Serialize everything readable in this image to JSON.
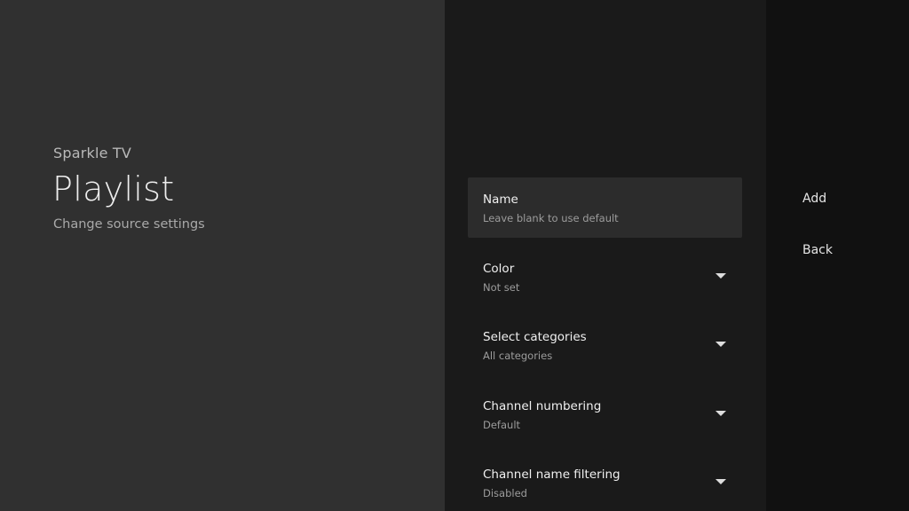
{
  "header": {
    "app_name": "Sparkle TV",
    "title": "Playlist",
    "subtitle": "Change source settings"
  },
  "settings": {
    "items": [
      {
        "title": "Name",
        "value": "Leave blank to use default",
        "focused": true,
        "icon": null
      },
      {
        "title": "Color",
        "value": "Not set",
        "icon": "dropdown-arrow"
      },
      {
        "title": "Select categories",
        "value": "All categories",
        "icon": "dropdown-arrow"
      },
      {
        "title": "Channel numbering",
        "value": "Default",
        "icon": "dropdown-arrow"
      },
      {
        "title": "Channel name filtering",
        "value": "Disabled",
        "icon": "dropdown-arrow"
      }
    ]
  },
  "actions": {
    "add_label": "Add",
    "back_label": "Back"
  },
  "colors": {
    "left_panel": "#303030",
    "middle_panel": "#1a1a1a",
    "right_panel": "#111111",
    "focused_item": "#2c2c2c"
  }
}
